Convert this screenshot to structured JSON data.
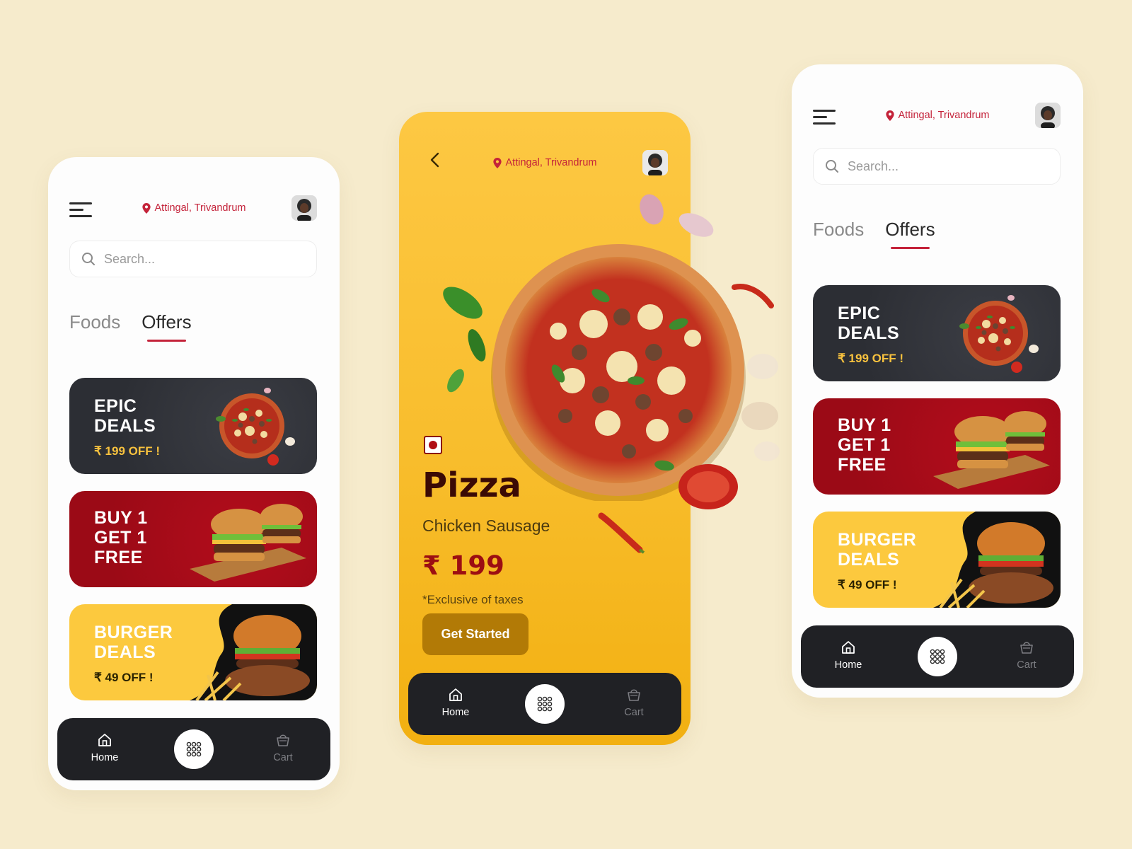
{
  "colors": {
    "background": "#f6ebcc",
    "accent_red": "#c4233a",
    "card_dark": "#2c2e34",
    "card_red": "#9b0a16",
    "card_yellow": "#fcc93e",
    "navbar": "#202125",
    "center_phone": "#f8bd2c",
    "cta": "#b27a06"
  },
  "common": {
    "location": "Attingal, Trivandrum",
    "search_placeholder": "Search...",
    "tabs": [
      {
        "label": "Foods",
        "active": false
      },
      {
        "label": "Offers",
        "active": true
      }
    ],
    "offers": [
      {
        "title": "EPIC\nDEALS",
        "subtitle": "₹ 199 OFF !",
        "image": "pizza"
      },
      {
        "title": "BUY 1\nGET 1\nFREE",
        "subtitle": "",
        "image": "double-burger"
      },
      {
        "title": "BURGER\nDEALS",
        "subtitle": "₹ 49 OFF !",
        "image": "burger-fries"
      }
    ],
    "nav": {
      "home": "Home",
      "menu_icon": "grid-icon",
      "cart": "Cart"
    }
  },
  "detail": {
    "title": "Pizza",
    "subtitle": "Chicken Sausage",
    "price": "₹ 199",
    "tax_note": "*Exclusive of taxes",
    "cta": "Get Started",
    "badge": "veg-nonveg-indicator"
  }
}
